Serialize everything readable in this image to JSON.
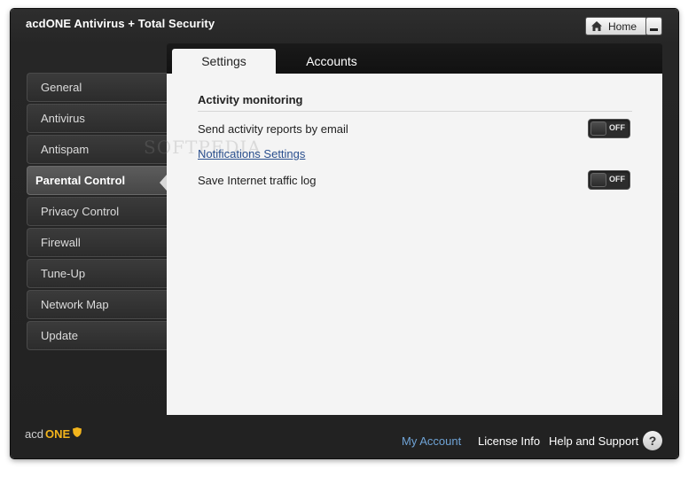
{
  "window": {
    "title": "acdONE Antivirus + Total Security"
  },
  "header": {
    "home_label": "Home"
  },
  "sidebar": {
    "items": [
      {
        "label": "General"
      },
      {
        "label": "Antivirus"
      },
      {
        "label": "Antispam"
      },
      {
        "label": "Parental Control",
        "active": true
      },
      {
        "label": "Privacy Control"
      },
      {
        "label": "Firewall"
      },
      {
        "label": "Tune-Up"
      },
      {
        "label": "Network Map"
      },
      {
        "label": "Update"
      }
    ]
  },
  "tabs": [
    {
      "label": "Settings",
      "active": true
    },
    {
      "label": "Accounts",
      "active": false
    }
  ],
  "content": {
    "section_title": "Activity monitoring",
    "rows": [
      {
        "label": "Send activity reports by email",
        "toggle": "OFF"
      },
      {
        "label": "Save Internet traffic log",
        "toggle": "OFF"
      }
    ],
    "notifications_link": "Notifications Settings",
    "watermark": "SOFTPEDIA"
  },
  "footer": {
    "logo_prefix": "acd",
    "logo_suffix": "ONE",
    "my_account": "My Account",
    "license_info": "License Info",
    "help_support": "Help and Support",
    "help_icon_glyph": "?"
  },
  "colors": {
    "accent_link": "#6fa3d6",
    "logo_accent": "#f2b41c",
    "content_bg": "#f4f4f4"
  },
  "icons": {
    "home": "home-icon",
    "minimize": "minimize-icon",
    "help": "help-icon",
    "shield": "shield-icon"
  }
}
